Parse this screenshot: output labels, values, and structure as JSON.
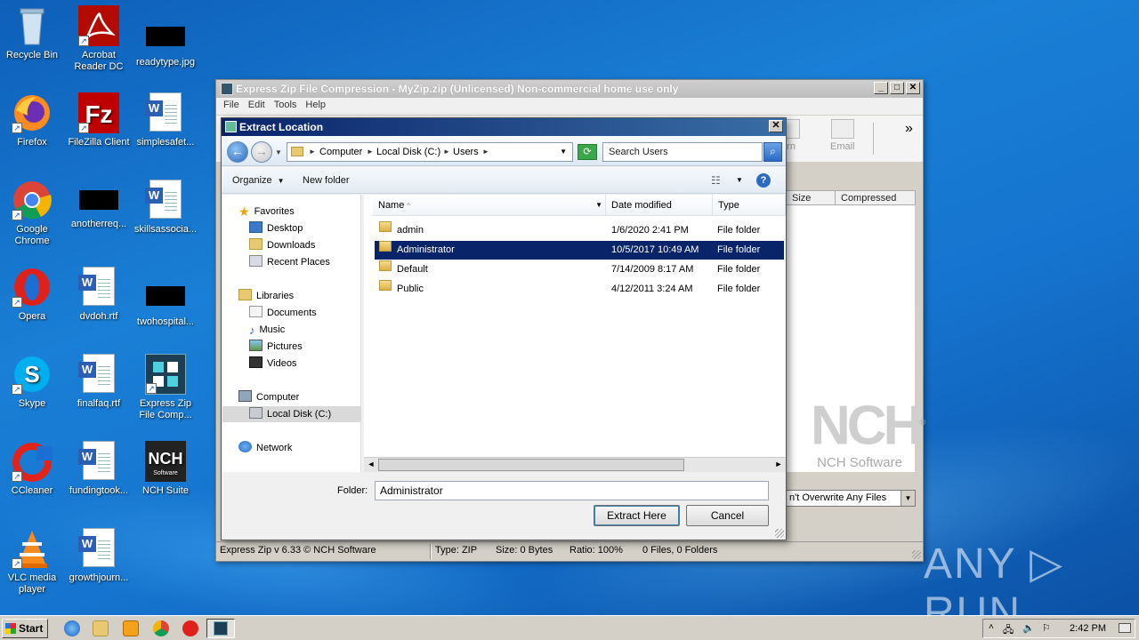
{
  "desktop": {
    "icons": [
      {
        "label": "Recycle Bin"
      },
      {
        "label": "Acrobat Reader DC"
      },
      {
        "label": "readytype.jpg"
      },
      {
        "label": "Firefox"
      },
      {
        "label": "FileZilla Client"
      },
      {
        "label": "simplesafet..."
      },
      {
        "label": "Google Chrome"
      },
      {
        "label": "anotherreq..."
      },
      {
        "label": "skillsassocia..."
      },
      {
        "label": "Opera"
      },
      {
        "label": "dvdoh.rtf"
      },
      {
        "label": "twohospital..."
      },
      {
        "label": "Skype"
      },
      {
        "label": "finalfaq.rtf"
      },
      {
        "label": "Express Zip File Comp..."
      },
      {
        "label": "CCleaner"
      },
      {
        "label": "fundingtook..."
      },
      {
        "label": "NCH Suite"
      },
      {
        "label": "VLC media player"
      },
      {
        "label": "growthjourn..."
      }
    ],
    "watermark": "ANY ▷ RUN"
  },
  "main_window": {
    "title": "Express Zip File Compression - MyZip.zip (Unlicensed) Non-commercial home use only",
    "menu": [
      "File",
      "Edit",
      "Tools",
      "Help"
    ],
    "toolbar": {
      "burn_label": "urn",
      "email_label": "Email",
      "more": "»"
    },
    "columns": {
      "size": "Size",
      "compressed": "Compressed"
    },
    "nch_logo": {
      "mark": "NCH",
      "reg": "®",
      "text": "NCH Software"
    },
    "overwrite_select": "n't Overwrite Any Files",
    "status": {
      "version": "Express Zip v 6.33 © NCH Software",
      "type": "Type: ZIP",
      "size": "Size: 0 Bytes",
      "ratio": "Ratio: 100%",
      "counts": "0 Files, 0 Folders"
    }
  },
  "dialog": {
    "title": "Extract Location",
    "breadcrumb": [
      "Computer",
      "Local Disk (C:)",
      "Users"
    ],
    "search_placeholder": "Search Users",
    "commands": {
      "organize": "Organize",
      "new_folder": "New folder"
    },
    "nav": {
      "favorites": "Favorites",
      "desktop": "Desktop",
      "downloads": "Downloads",
      "recent": "Recent Places",
      "libraries": "Libraries",
      "documents": "Documents",
      "music": "Music",
      "pictures": "Pictures",
      "videos": "Videos",
      "computer": "Computer",
      "local_disk": "Local Disk (C:)",
      "network": "Network"
    },
    "columns": {
      "name": "Name",
      "date": "Date modified",
      "type": "Type"
    },
    "files": [
      {
        "name": "admin",
        "date": "1/6/2020 2:41 PM",
        "type": "File folder"
      },
      {
        "name": "Administrator",
        "date": "10/5/2017 10:49 AM",
        "type": "File folder"
      },
      {
        "name": "Default",
        "date": "7/14/2009 8:17 AM",
        "type": "File folder"
      },
      {
        "name": "Public",
        "date": "4/12/2011 3:24 AM",
        "type": "File folder"
      }
    ],
    "folder_label": "Folder:",
    "folder_value": "Administrator",
    "buttons": {
      "extract": "Extract Here",
      "cancel": "Cancel"
    }
  },
  "taskbar": {
    "start": "Start",
    "clock": "2:42 PM"
  }
}
